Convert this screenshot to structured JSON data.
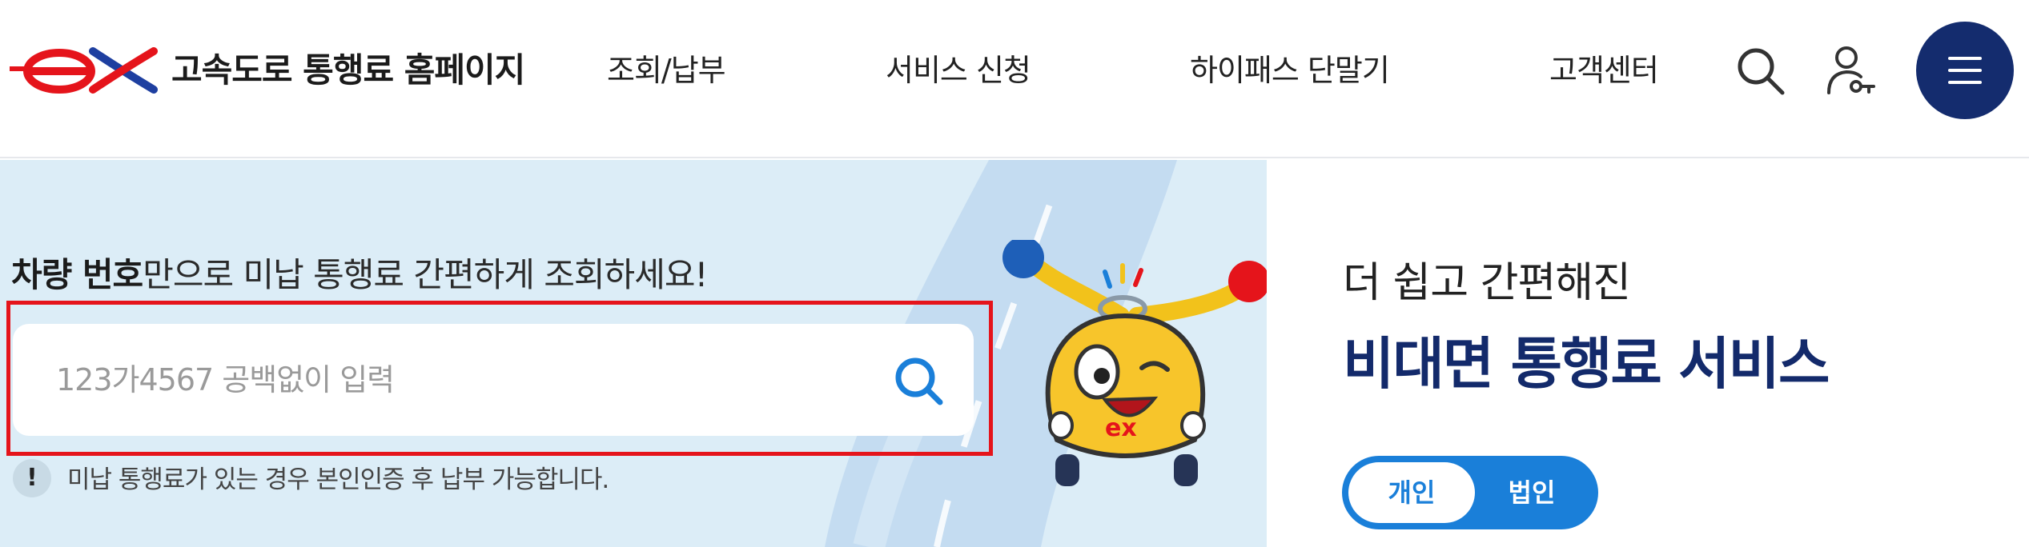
{
  "header": {
    "site_title": "고속도로 통행료 홈페이지",
    "nav": [
      "조회/납부",
      "서비스 신청",
      "하이패스 단말기",
      "고객센터"
    ]
  },
  "banner": {
    "tagline_bold": "차량 번호",
    "tagline_rest": "만으로 미납 통행료 간편하게 조회하세요!",
    "search_placeholder": "123가4567 공백없이 입력",
    "notice_icon": "!",
    "notice": "미납 통행료가 있는 경우 본인인증 후 납부 가능합니다.",
    "mascot_logo": "ex"
  },
  "panel": {
    "subtitle": "더 쉽고 간편해진",
    "title": "비대면 통행료 서비스",
    "toggle": [
      "개인",
      "법인"
    ]
  },
  "colors": {
    "brand_red": "#e5141b",
    "brand_navy": "#142c6e",
    "accent_blue": "#1a7fd9",
    "banner_bg": "#dcedf7"
  },
  "icons": {
    "logo": "ex-logo",
    "search": "search-icon",
    "user": "user-key-icon",
    "menu": "hamburger-icon",
    "input_search": "search-icon",
    "notice": "exclamation-icon"
  }
}
